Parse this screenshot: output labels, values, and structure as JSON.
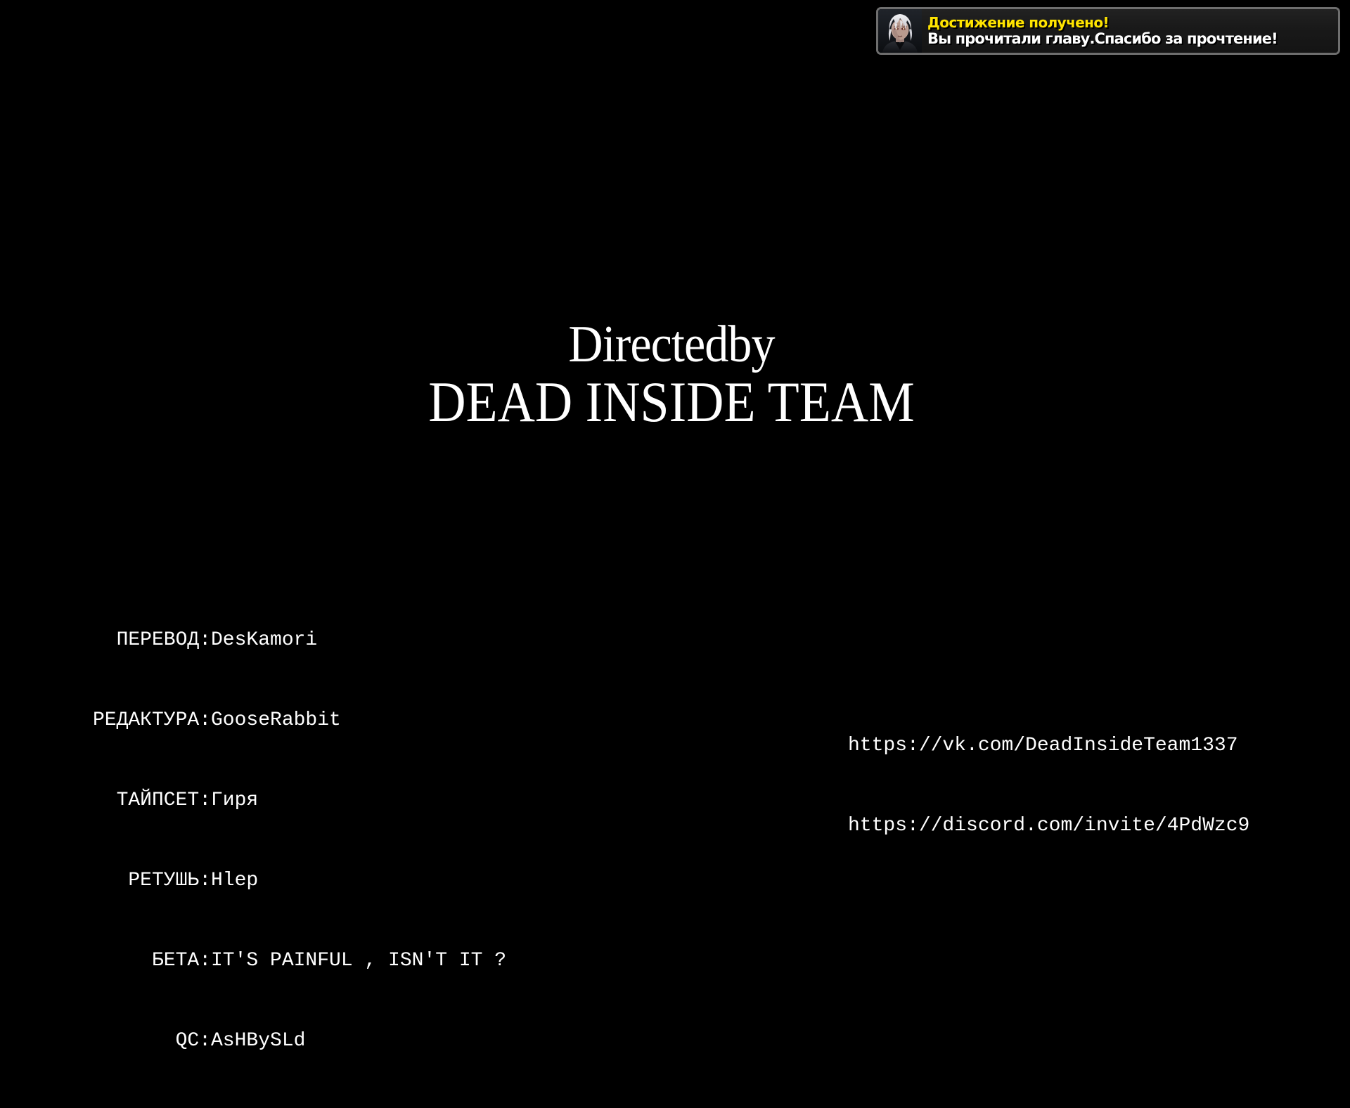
{
  "background_color": "#000000",
  "achievement": {
    "icon": "character-portrait-avatar",
    "title": "Достижение получено!",
    "description": "Вы прочитали главу.Спасибо за прочтение!",
    "title_color": "#ffe400",
    "description_color": "#ffffff",
    "border_color": "#6e6e6e",
    "background_color": "#1b1b1b"
  },
  "credits_title": {
    "line1": "Directedby",
    "line2": "DEAD INSIDE TEAM",
    "color": "#ffffff"
  },
  "staff": {
    "rows": [
      {
        "label": "ПЕРЕВОД:",
        "value": "DesKamori"
      },
      {
        "label": "РЕДАКТУРА:",
        "value": "GooseRabbit"
      },
      {
        "label": "ТАЙПСЕТ:",
        "value": "Гиря"
      },
      {
        "label": "РЕТУШЬ:",
        "value": "Hlep"
      },
      {
        "label": "БЕТА:",
        "value": "IT'S PAINFUL , ISN'T IT ?"
      },
      {
        "label": "QC:",
        "value": "AsHBySLd"
      }
    ]
  },
  "links": {
    "items": [
      "https://vk.com/DeadInsideTeam1337",
      "https://discord.com/invite/4PdWzc9"
    ]
  }
}
